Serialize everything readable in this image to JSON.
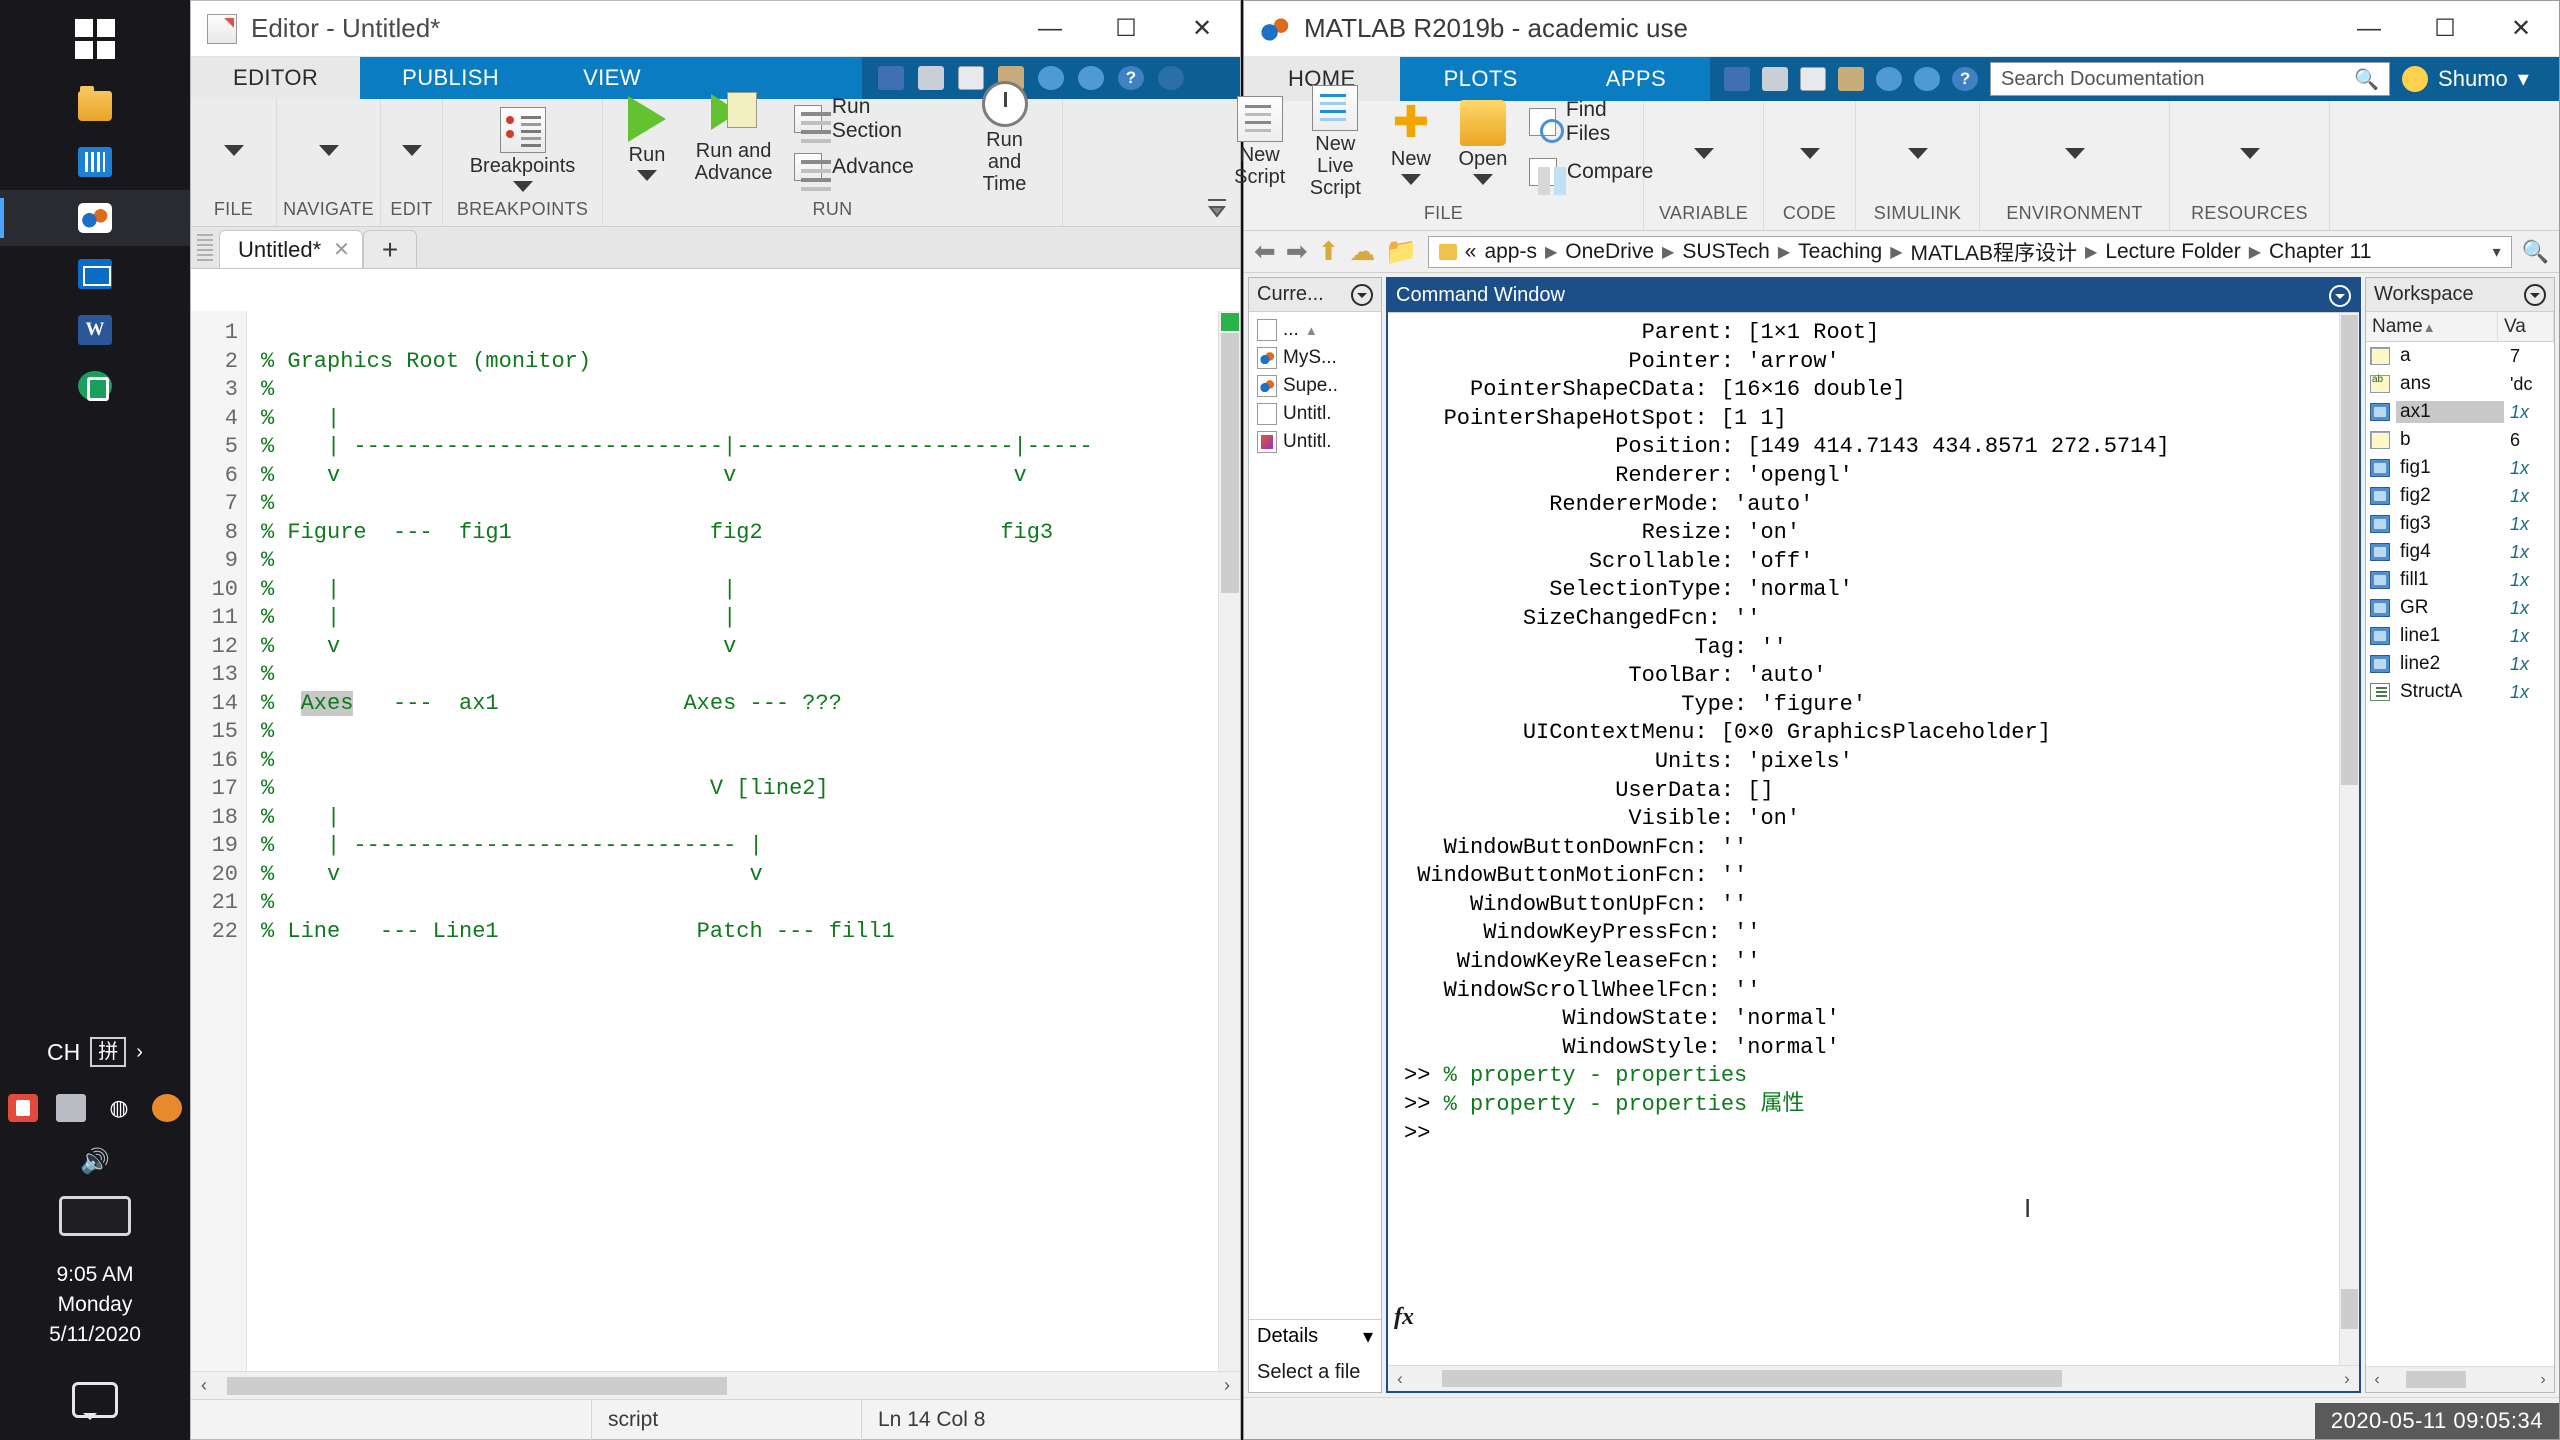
{
  "taskbar": {
    "start_label": "start-windows",
    "items": [
      {
        "name": "file-explorer",
        "icon": "folder-icon"
      },
      {
        "name": "microsoft-store",
        "icon": "store-icon"
      },
      {
        "name": "matlab",
        "icon": "matlab-icon"
      },
      {
        "name": "mail",
        "icon": "mail-icon"
      },
      {
        "name": "word",
        "icon": "word-icon",
        "glyph": "W"
      },
      {
        "name": "app-green",
        "icon": "green-app-icon"
      }
    ],
    "ime": {
      "lang": "CH",
      "mode": "拼"
    },
    "clock": {
      "time": "9:05 AM",
      "weekday": "Monday",
      "date": "5/11/2020"
    }
  },
  "editor": {
    "window_title": "Editor - Untitled*",
    "window_buttons": {
      "minimize": "—",
      "maximize": "☐",
      "close": "✕"
    },
    "ribbon_tabs": [
      {
        "label": "EDITOR",
        "active": true
      },
      {
        "label": "PUBLISH",
        "active": false
      },
      {
        "label": "VIEW",
        "active": false
      }
    ],
    "groups": [
      {
        "label": "FILE"
      },
      {
        "label": "NAVIGATE"
      },
      {
        "label": "EDIT"
      },
      {
        "label": "BREAKPOINTS"
      },
      {
        "label": "RUN"
      }
    ],
    "buttons": {
      "breakpoints": "Breakpoints",
      "run": "Run",
      "run_and_advance": "Run and\nAdvance",
      "run_section": "Run Section",
      "advance": "Advance",
      "run_and_time": "Run and\nTime"
    },
    "file_tabs": [
      {
        "label": "Untitled*",
        "close": "✕",
        "active": true
      }
    ],
    "new_tab_label": "+",
    "line_numbers": [
      1,
      2,
      3,
      4,
      5,
      6,
      7,
      8,
      9,
      10,
      11,
      12,
      13,
      14,
      15,
      16,
      17,
      18,
      19,
      20,
      21,
      22
    ],
    "code_lines": [
      "",
      "% Graphics Root (monitor)",
      "%",
      "%    |",
      "%    | ----------------------------|---------------------|-----",
      "%    v                             v                     v",
      "%",
      "% Figure  ---  fig1               fig2                  fig3",
      "%",
      "%    |                             |",
      "%    |                             |",
      "%    v                             v",
      "%",
      "%  Axes   ---  ax1              Axes --- ???",
      "%",
      "%",
      "%                                 V [line2]",
      "%    |",
      "%    | ----------------------------- |",
      "%    v                               v",
      "%",
      "% Line   --- Line1               Patch --- fill1"
    ],
    "highlighted_token": "Axes",
    "status": {
      "file_type": "script",
      "position": "Ln  14  Col  8"
    }
  },
  "matlab": {
    "window_title": "MATLAB R2019b - academic use",
    "window_buttons": {
      "minimize": "—",
      "maximize": "☐",
      "close": "✕"
    },
    "ribbon_tabs": [
      {
        "label": "HOME",
        "active": true
      },
      {
        "label": "PLOTS",
        "active": false
      },
      {
        "label": "APPS",
        "active": false
      }
    ],
    "search": {
      "placeholder": "Search Documentation",
      "icon": "search-icon"
    },
    "user": {
      "name": "Shumo",
      "caret": "▾"
    },
    "ribbon_buttons": {
      "new_script": "New\nScript",
      "new_live_script": "New\nLive Script",
      "new": "New",
      "open": "Open",
      "find_files": "Find Files",
      "compare": "Compare"
    },
    "ribbon_groups": [
      "FILE",
      "VARIABLE",
      "CODE",
      "SIMULINK",
      "ENVIRONMENT",
      "RESOURCES"
    ],
    "address_path": [
      "app-s",
      "OneDrive",
      "SUSTech",
      "Teaching",
      "MATLAB程序设计",
      "Lecture Folder",
      "Chapter 11"
    ],
    "address_prefix": "«",
    "current_folder": {
      "title": "Curre...",
      "up_entry": "...",
      "files": [
        {
          "name": "MyS...",
          "type": "m"
        },
        {
          "name": "Supe..",
          "type": "m"
        },
        {
          "name": "Untitl.",
          "type": "blank"
        },
        {
          "name": "Untitl.",
          "type": "r"
        }
      ],
      "details_label": "Details",
      "select_hint": "Select a file"
    },
    "command_window": {
      "title": "Command Window",
      "lines": [
        {
          "t": "out",
          "s": "                  Parent: [1×1 Root]"
        },
        {
          "t": "out",
          "s": "                 Pointer: 'arrow'"
        },
        {
          "t": "out",
          "s": "     PointerShapeCData: [16×16 double]"
        },
        {
          "t": "out",
          "s": "   PointerShapeHotSpot: [1 1]"
        },
        {
          "t": "out",
          "s": "                Position: [149 414.7143 434.8571 272.5714]"
        },
        {
          "t": "out",
          "s": "                Renderer: 'opengl'"
        },
        {
          "t": "out",
          "s": "           RendererMode: 'auto'"
        },
        {
          "t": "out",
          "s": "                  Resize: 'on'"
        },
        {
          "t": "out",
          "s": "              Scrollable: 'off'"
        },
        {
          "t": "out",
          "s": "           SelectionType: 'normal'"
        },
        {
          "t": "out",
          "s": "         SizeChangedFcn: ''"
        },
        {
          "t": "out",
          "s": "                      Tag: ''"
        },
        {
          "t": "out",
          "s": "                 ToolBar: 'auto'"
        },
        {
          "t": "out",
          "s": "                     Type: 'figure'"
        },
        {
          "t": "out",
          "s": "         UIContextMenu: [0×0 GraphicsPlaceholder]"
        },
        {
          "t": "out",
          "s": "                   Units: 'pixels'"
        },
        {
          "t": "out",
          "s": "                UserData: []"
        },
        {
          "t": "out",
          "s": "                 Visible: 'on'"
        },
        {
          "t": "out",
          "s": "   WindowButtonDownFcn: ''"
        },
        {
          "t": "out",
          "s": " WindowButtonMotionFcn: ''"
        },
        {
          "t": "out",
          "s": "     WindowButtonUpFcn: ''"
        },
        {
          "t": "out",
          "s": "      WindowKeyPressFcn: ''"
        },
        {
          "t": "out",
          "s": "    WindowKeyReleaseFcn: ''"
        },
        {
          "t": "out",
          "s": "   WindowScrollWheelFcn: ''"
        },
        {
          "t": "out",
          "s": "            WindowState: 'normal'"
        },
        {
          "t": "out",
          "s": "            WindowStyle: 'normal'"
        }
      ],
      "commands": [
        {
          "prompt": ">> ",
          "text": "% property - properties"
        },
        {
          "prompt": ">> ",
          "text": "% property - properties 属性"
        }
      ],
      "final_prompt": ">>",
      "fx_label": "fx"
    },
    "workspace": {
      "title": "Workspace",
      "columns": [
        "Name",
        "Va"
      ],
      "sort_indicator": "▲",
      "rows": [
        {
          "name": "a",
          "value": "7",
          "kind": "grid",
          "italic": false,
          "selected": false
        },
        {
          "name": "ans",
          "value": "'dc",
          "kind": "str",
          "italic": false,
          "selected": false
        },
        {
          "name": "ax1",
          "value": "1x",
          "kind": "obj",
          "italic": true,
          "selected": true
        },
        {
          "name": "b",
          "value": "6",
          "kind": "grid",
          "italic": false,
          "selected": false
        },
        {
          "name": "fig1",
          "value": "1x",
          "kind": "obj",
          "italic": true,
          "selected": false
        },
        {
          "name": "fig2",
          "value": "1x",
          "kind": "obj",
          "italic": true,
          "selected": false
        },
        {
          "name": "fig3",
          "value": "1x",
          "kind": "obj",
          "italic": true,
          "selected": false
        },
        {
          "name": "fig4",
          "value": "1x",
          "kind": "obj",
          "italic": true,
          "selected": false
        },
        {
          "name": "fill1",
          "value": "1x",
          "kind": "obj",
          "italic": true,
          "selected": false
        },
        {
          "name": "GR",
          "value": "1x",
          "kind": "obj",
          "italic": true,
          "selected": false
        },
        {
          "name": "line1",
          "value": "1x",
          "kind": "obj",
          "italic": true,
          "selected": false
        },
        {
          "name": "line2",
          "value": "1x",
          "kind": "obj",
          "italic": true,
          "selected": false
        },
        {
          "name": "StructA",
          "value": "1x",
          "kind": "struct",
          "italic": true,
          "selected": false
        }
      ]
    },
    "clock_badge": "2020-05-11 09:05:34"
  }
}
